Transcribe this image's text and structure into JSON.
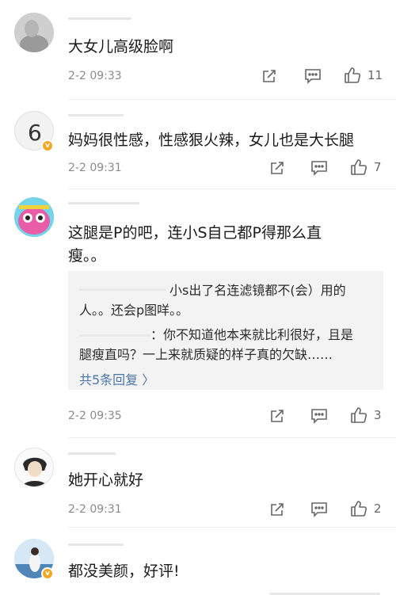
{
  "comments": [
    {
      "text": "大女儿高级脸啊",
      "time": "2-2 09:33",
      "likes": "11"
    },
    {
      "text": "妈妈很性感，性感狠火辣，女儿也是大长腿",
      "time": "2-2 09:31",
      "likes": "7",
      "badge": "v"
    },
    {
      "text_line1": "这腿是P的吧，连小S自己都P得那么直",
      "text_line2": "瘦。。",
      "time": "2-2 09:35",
      "likes": "3",
      "replies": {
        "r1_line1": "小s出了名连滤镜都不(会）用的",
        "r1_line2": "人。。还会p图咩。。",
        "r2_line1": "：你不知道他本来就比利很好，且是",
        "r2_line2": "腿瘦直吗？一上来就质疑的样子真的欠缺……",
        "more": "共5条回复 〉"
      }
    },
    {
      "text": "她开心就好",
      "time": "2-2 09:31",
      "likes": "2"
    },
    {
      "text": "都没美颜，好评!",
      "badge": "v"
    }
  ],
  "icons": {
    "share": "share-icon",
    "comment": "comment-icon",
    "like": "thumbs-up-icon"
  },
  "colors": {
    "badge": "#f5a623",
    "link": "#4a76a8",
    "time": "#8a8a8a"
  }
}
